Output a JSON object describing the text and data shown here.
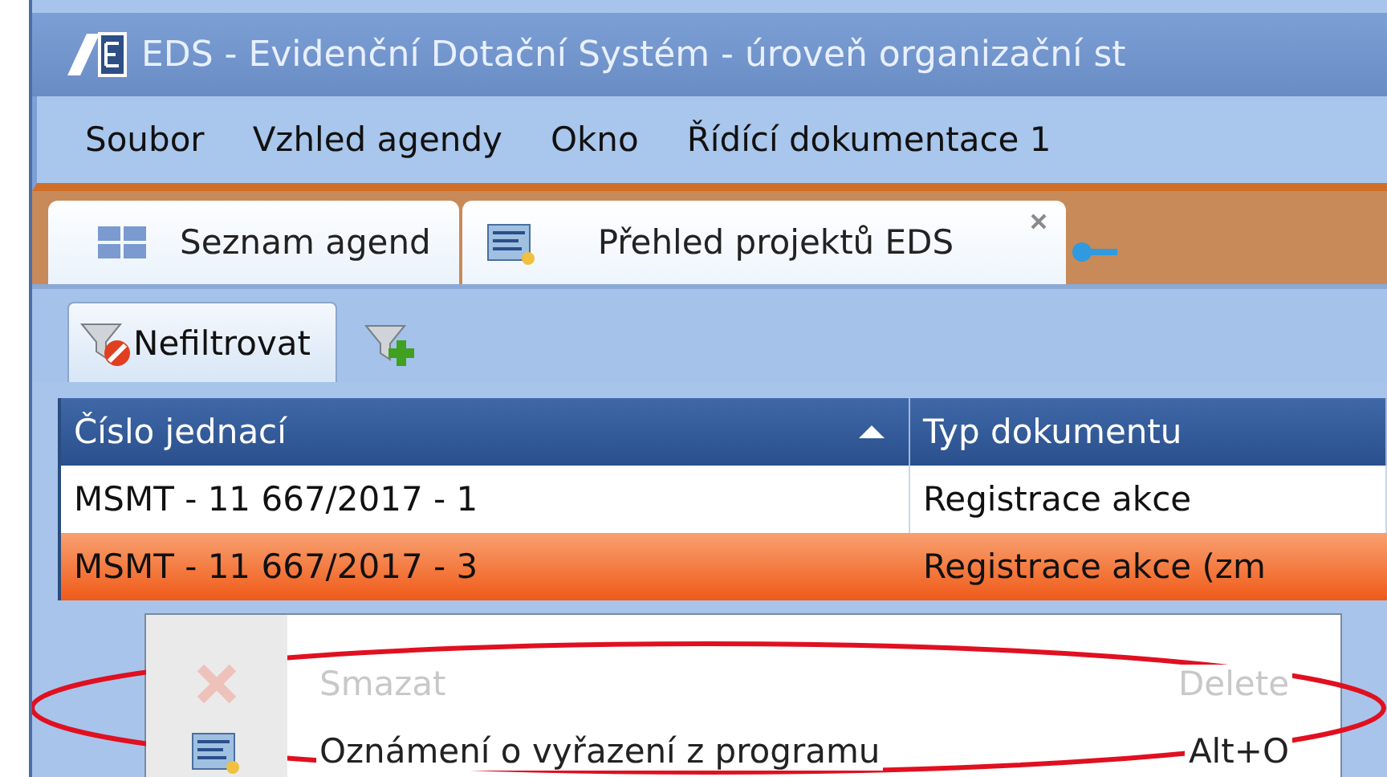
{
  "window": {
    "title": "EDS - Evidenční Dotační Systém - úroveň organizační st"
  },
  "menu": [
    "Soubor",
    "Vzhled agendy",
    "Okno",
    "Řídící dokumentace 1"
  ],
  "tabs": [
    {
      "label": "Seznam agend",
      "selected": false
    },
    {
      "label": "Přehled projektů EDS",
      "selected": true
    }
  ],
  "toolbar": {
    "filter_button": "Nefiltrovat"
  },
  "table": {
    "columns": [
      {
        "label": "Číslo jednací",
        "sorted": true
      },
      {
        "label": "Typ dokumentu",
        "sorted": false
      }
    ],
    "rows": [
      {
        "cells": [
          "MSMT - 11 667/2017 - 1",
          "Registrace akce"
        ],
        "selected": false
      },
      {
        "cells": [
          "MSMT - 11 667/2017 - 3",
          "Registrace akce (zm"
        ],
        "selected": true
      }
    ]
  },
  "context_menu": [
    {
      "label": "Smazat",
      "shortcut": "Delete",
      "disabled": true
    },
    {
      "label": "Oznámení o vyřazení z programu",
      "shortcut": "Alt+O",
      "disabled": false
    }
  ]
}
